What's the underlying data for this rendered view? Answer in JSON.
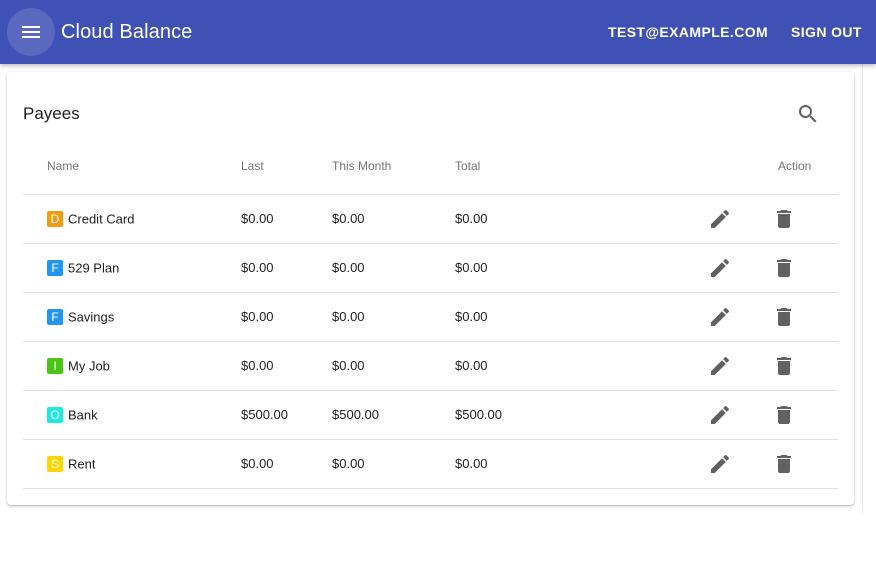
{
  "app": {
    "title": "Cloud Balance",
    "user": "TEST@EXAMPLE.COM",
    "signout_label": "SIGN OUT",
    "menu_icon": "menu-icon"
  },
  "colors": {
    "primary": "#3f51b5",
    "badge_d": "#f39c12",
    "badge_f": "#2196f3",
    "badge_i": "#4cc417",
    "badge_o": "#1de9e0",
    "badge_s": "#ffd600"
  },
  "payees": {
    "title": "Payees",
    "search_icon": "search-icon",
    "columns": {
      "name": "Name",
      "last": "Last",
      "this_month": "This Month",
      "total": "Total",
      "action": "Action"
    },
    "rows": [
      {
        "badge": "D",
        "badge_color": "#f39c12",
        "name": "Credit Card",
        "last": "$0.00",
        "this_month": "$0.00",
        "total": "$0.00"
      },
      {
        "badge": "F",
        "badge_color": "#2196f3",
        "name": "529 Plan",
        "last": "$0.00",
        "this_month": "$0.00",
        "total": "$0.00"
      },
      {
        "badge": "F",
        "badge_color": "#2196f3",
        "name": "Savings",
        "last": "$0.00",
        "this_month": "$0.00",
        "total": "$0.00"
      },
      {
        "badge": "I",
        "badge_color": "#4cc417",
        "name": "My Job",
        "last": "$0.00",
        "this_month": "$0.00",
        "total": "$0.00"
      },
      {
        "badge": "O",
        "badge_color": "#1de9e0",
        "name": "Bank",
        "last": "$500.00",
        "this_month": "$500.00",
        "total": "$500.00"
      },
      {
        "badge": "S",
        "badge_color": "#ffd600",
        "name": "Rent",
        "last": "$0.00",
        "this_month": "$0.00",
        "total": "$0.00"
      }
    ]
  }
}
